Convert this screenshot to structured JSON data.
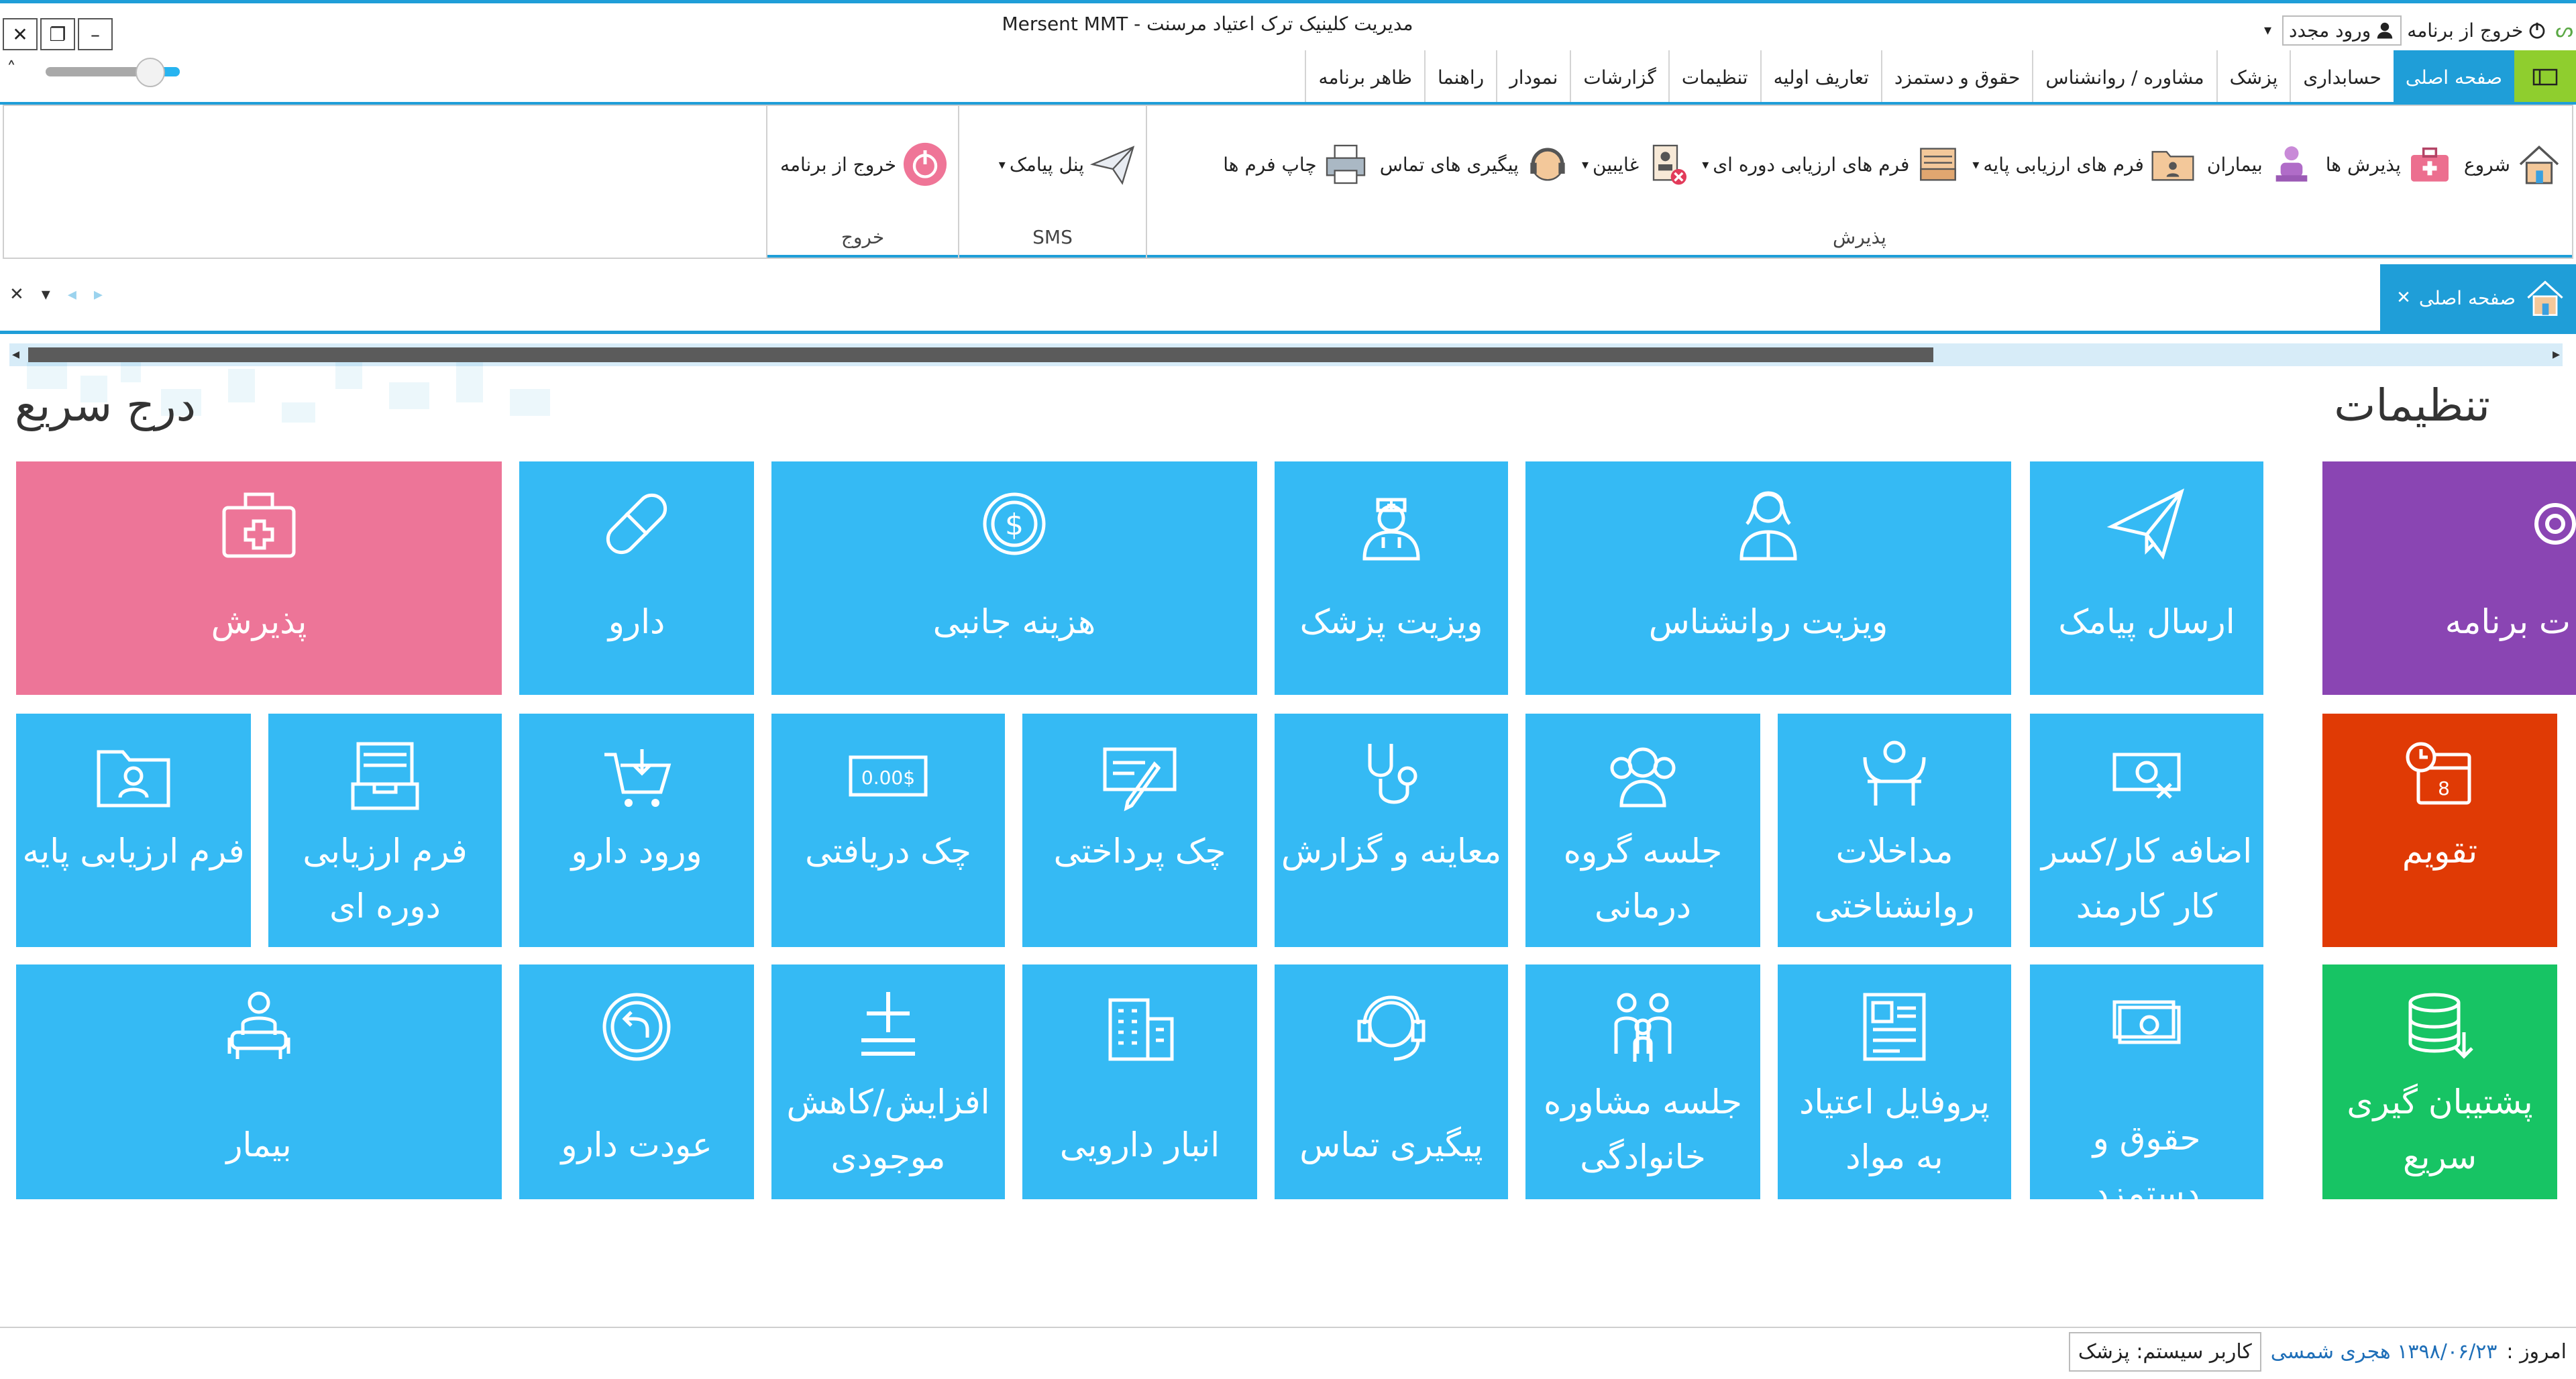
{
  "window": {
    "title": "مدیریت کلینیک ترک اعتیاد مرسنت - Mersent MMT",
    "close": "✕",
    "restore": "❐",
    "minimize": "–"
  },
  "quick_access": {
    "exit": "خروج از برنامه",
    "relogin": "ورود مجدد",
    "dropdown": "▾"
  },
  "zoom_slider": {
    "level": 0.78
  },
  "ribbon_tabs": [
    {
      "label": "صفحه اصلی",
      "active": true
    },
    {
      "label": "حسابداری"
    },
    {
      "label": "پزشک"
    },
    {
      "label": "مشاوره / روانشناس"
    },
    {
      "label": "حقوق و دستمزد"
    },
    {
      "label": "تعاریف اولیه"
    },
    {
      "label": "تنظیمات"
    },
    {
      "label": "گزارشات"
    },
    {
      "label": "نمودار"
    },
    {
      "label": "راهنما"
    },
    {
      "label": "ظاهر برنامه"
    }
  ],
  "ribbon": {
    "reception_group": {
      "label": "پذیرش",
      "items": [
        "شروع",
        "پذیرش ها",
        "بیماران",
        "فرم های ارزیابی پایه",
        "فرم های ارزیابی دوره ای",
        "غایبین",
        "پیگیری های تماس",
        "چاپ فرم ها"
      ]
    },
    "sms_group": {
      "label": "SMS",
      "item": "پنل پیامک"
    },
    "exit_group": {
      "label": "خروج",
      "item": "خروج از برنامه"
    }
  },
  "doc_tab": {
    "label": "صفحه اصلی",
    "close": "✕"
  },
  "doc_controls": {
    "close": "✕",
    "menu": "▾",
    "prev": "◂",
    "next": "▸"
  },
  "sections": {
    "settings_title": "تنظیمات",
    "quick_title": "درج سریع"
  },
  "tiles": {
    "settings_program": "ت برنامه",
    "calendar": "تقویم",
    "backup": "پشتیبان گیری سریع",
    "send_sms": "ارسال پیامک",
    "psych_visit": "ویزیت روانشناس",
    "doctor_visit": "ویزیت پزشک",
    "side_cost": "هزینه جانبی",
    "medicine": "دارو",
    "reception": "پذیرش",
    "overtime": "اضافه کار/کسر کار کارمند",
    "psych_interventions": "مداخلات روانشناختی",
    "group_therapy": "جلسه گروه درمانی",
    "exam_report": "معاینه و گزارش",
    "check_paid": "چک پرداختی",
    "check_received": "چک دریافتی",
    "medicine_entry": "ورود دارو",
    "periodic_form": "فرم ارزیابی دوره ای",
    "basic_form": "فرم ارزیابی پایه",
    "salary": "حقوق و دستمزد",
    "addiction_profile": "پروفایل اعتیاد به مواد",
    "family_counseling": "جلسه مشاوره خانوادگی",
    "call_followup": "پیگیری تماس",
    "pharmacy": "انبار دارویی",
    "stock_adjust": "افزایش/کاهش موجودی",
    "medicine_return": "عودت دارو",
    "patient": "بیمار"
  },
  "status_bar": {
    "today_label": "امروز :",
    "date": "۱۳۹۸/۰۶/۲۳ هجری شمسی",
    "user": "کاربر سیستم: پزشک"
  },
  "colors": {
    "accent": "#1f9ed8",
    "tile_blue": "#35baf4",
    "tile_pink": "#ed7598",
    "tile_purple": "#8a45b3",
    "tile_orange": "#e03a05",
    "tile_green": "#17c464"
  }
}
